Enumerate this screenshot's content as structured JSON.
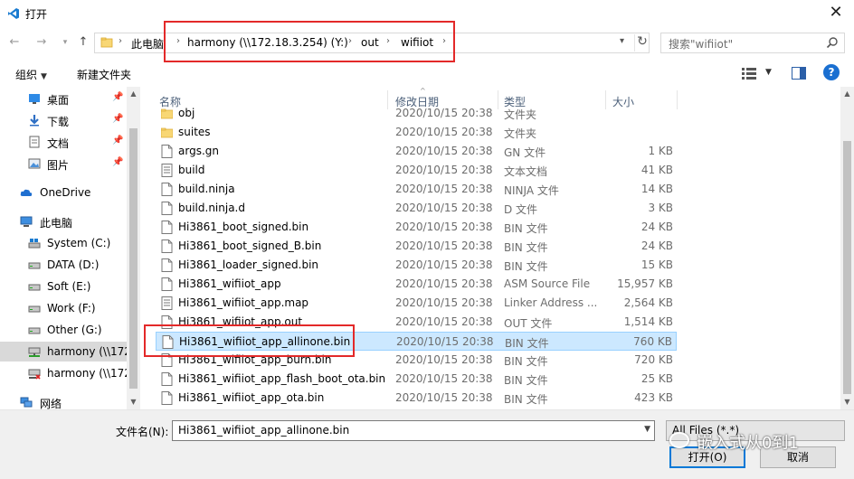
{
  "window": {
    "title": "打开",
    "close": "✕"
  },
  "address": {
    "crumbs": [
      "此电脑",
      "harmony (\\\\172.18.3.254) (Y:)",
      "out",
      "wifiiot"
    ],
    "separator": "›",
    "search_placeholder": "搜索\"wifiiot\""
  },
  "toolbar": {
    "organize": "组织",
    "new_folder": "新建文件夹",
    "help": "?"
  },
  "sidebar": {
    "items": [
      {
        "label": "桌面",
        "pinned": true
      },
      {
        "label": "下载",
        "pinned": true
      },
      {
        "label": "文档",
        "pinned": true
      },
      {
        "label": "图片",
        "pinned": true
      },
      {
        "label": "OneDrive"
      },
      {
        "label": "此电脑"
      },
      {
        "label": "System (C:)"
      },
      {
        "label": "DATA (D:)"
      },
      {
        "label": "Soft (E:)"
      },
      {
        "label": "Work (F:)"
      },
      {
        "label": "Other (G:)"
      },
      {
        "label": "harmony (\\\\172"
      },
      {
        "label": "harmony (\\\\172"
      },
      {
        "label": "网络"
      }
    ]
  },
  "columns": {
    "name": "名称",
    "date": "修改日期",
    "type": "类型",
    "size": "大小"
  },
  "files": [
    {
      "name": "obj",
      "date": "2020/10/15 20:38",
      "type": "文件夹",
      "size": "",
      "kind": "folder"
    },
    {
      "name": "suites",
      "date": "2020/10/15 20:38",
      "type": "文件夹",
      "size": "",
      "kind": "folder"
    },
    {
      "name": "args.gn",
      "date": "2020/10/15 20:38",
      "type": "GN 文件",
      "size": "1 KB",
      "kind": "file"
    },
    {
      "name": "build",
      "date": "2020/10/15 20:38",
      "type": "文本文档",
      "size": "41 KB",
      "kind": "text"
    },
    {
      "name": "build.ninja",
      "date": "2020/10/15 20:38",
      "type": "NINJA 文件",
      "size": "14 KB",
      "kind": "file"
    },
    {
      "name": "build.ninja.d",
      "date": "2020/10/15 20:38",
      "type": "D 文件",
      "size": "3 KB",
      "kind": "file"
    },
    {
      "name": "Hi3861_boot_signed.bin",
      "date": "2020/10/15 20:38",
      "type": "BIN 文件",
      "size": "24 KB",
      "kind": "file"
    },
    {
      "name": "Hi3861_boot_signed_B.bin",
      "date": "2020/10/15 20:38",
      "type": "BIN 文件",
      "size": "24 KB",
      "kind": "file"
    },
    {
      "name": "Hi3861_loader_signed.bin",
      "date": "2020/10/15 20:38",
      "type": "BIN 文件",
      "size": "15 KB",
      "kind": "file"
    },
    {
      "name": "Hi3861_wifiiot_app",
      "date": "2020/10/15 20:38",
      "type": "ASM Source File",
      "size": "15,957 KB",
      "kind": "file"
    },
    {
      "name": "Hi3861_wifiiot_app.map",
      "date": "2020/10/15 20:38",
      "type": "Linker Address ...",
      "size": "2,564 KB",
      "kind": "text"
    },
    {
      "name": "Hi3861_wifiiot_app.out",
      "date": "2020/10/15 20:38",
      "type": "OUT 文件",
      "size": "1,514 KB",
      "kind": "file"
    },
    {
      "name": "Hi3861_wifiiot_app_allinone.bin",
      "date": "2020/10/15 20:38",
      "type": "BIN 文件",
      "size": "760 KB",
      "kind": "file",
      "selected": true
    },
    {
      "name": "Hi3861_wifiiot_app_burn.bin",
      "date": "2020/10/15 20:38",
      "type": "BIN 文件",
      "size": "720 KB",
      "kind": "file"
    },
    {
      "name": "Hi3861_wifiiot_app_flash_boot_ota.bin",
      "date": "2020/10/15 20:38",
      "type": "BIN 文件",
      "size": "25 KB",
      "kind": "file"
    },
    {
      "name": "Hi3861_wifiiot_app_ota.bin",
      "date": "2020/10/15 20:38",
      "type": "BIN 文件",
      "size": "423 KB",
      "kind": "file"
    }
  ],
  "footer": {
    "filename_label": "文件名(N):",
    "filename_value": "Hi3861_wifiiot_app_allinone.bin",
    "filter": "All Files (*.*)",
    "open": "打开(O)",
    "cancel": "取消",
    "watermark": "嵌入式从0到1"
  },
  "colors": {
    "accent": "#0078d7",
    "highlight": "#e32929",
    "selection": "#cce8ff",
    "folder": "#f8d775"
  }
}
